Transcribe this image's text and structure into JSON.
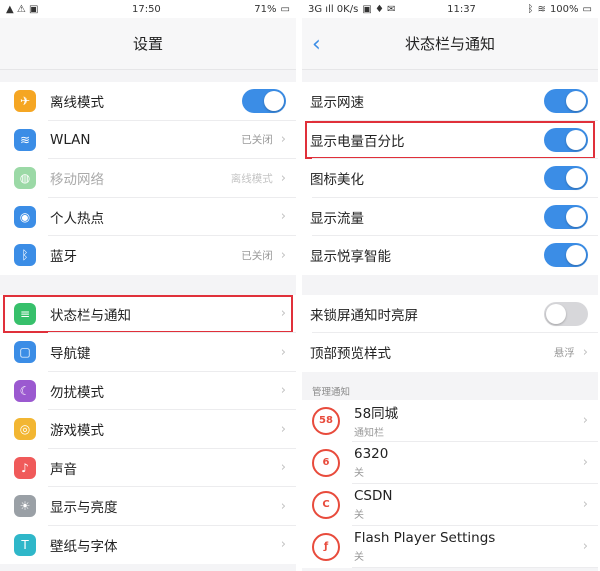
{
  "left": {
    "status": {
      "time": "17:50",
      "battery": "71%"
    },
    "title": "设置",
    "groups": [
      [
        {
          "label": "离线模式",
          "icon": "airplane-icon",
          "color": "#f5a623",
          "glyph": "✈",
          "control": "toggle-on"
        },
        {
          "label": "WLAN",
          "icon": "wifi-icon",
          "color": "#3b8de6",
          "glyph": "≋",
          "value": "已关闭"
        },
        {
          "label": "移动网络",
          "icon": "mobile-network-icon",
          "color": "#9bd9a6",
          "glyph": "◍",
          "value": "离线模式",
          "disabled": true
        },
        {
          "label": "个人热点",
          "icon": "hotspot-icon",
          "color": "#3b8de6",
          "glyph": "◉"
        },
        {
          "label": "蓝牙",
          "icon": "bluetooth-icon",
          "color": "#3b8de6",
          "glyph": "ᛒ",
          "value": "已关闭"
        }
      ],
      [
        {
          "label": "状态栏与通知",
          "icon": "statusbar-icon",
          "color": "#37c06b",
          "glyph": "≡",
          "highlight": true
        },
        {
          "label": "导航键",
          "icon": "navigation-key-icon",
          "color": "#3b8de6",
          "glyph": "▢"
        },
        {
          "label": "勿扰模式",
          "icon": "moon-icon",
          "color": "#9b59d0",
          "glyph": "☾"
        },
        {
          "label": "游戏模式",
          "icon": "gamepad-icon",
          "color": "#f2b632",
          "glyph": "◎"
        },
        {
          "label": "声音",
          "icon": "sound-icon",
          "color": "#f05a5a",
          "glyph": "♪"
        },
        {
          "label": "显示与亮度",
          "icon": "brightness-icon",
          "color": "#9aa0a6",
          "glyph": "☀"
        },
        {
          "label": "壁纸与字体",
          "icon": "wallpaper-font-icon",
          "color": "#2fb7c9",
          "glyph": "T"
        }
      ]
    ]
  },
  "right": {
    "status": {
      "left": "3G ıll 0K/s",
      "time": "11:37",
      "battery": "100%"
    },
    "title": "状态栏与通知",
    "groups": [
      [
        {
          "label": "显示网速",
          "control": "toggle-on"
        },
        {
          "label": "显示电量百分比",
          "control": "toggle-on",
          "highlight": true
        },
        {
          "label": "图标美化",
          "control": "toggle-on"
        },
        {
          "label": "显示流量",
          "control": "toggle-on"
        },
        {
          "label": "显示悦享智能",
          "control": "toggle-on"
        }
      ],
      [
        {
          "label": "来锁屏通知时亮屏",
          "control": "toggle-off"
        },
        {
          "label": "顶部预览样式",
          "value": "悬浮"
        }
      ]
    ],
    "section_header": "管理通知",
    "apps": [
      {
        "name": "58同城",
        "sub": "通知栏",
        "color": "#e84b3c",
        "glyph": "58"
      },
      {
        "name": "6320",
        "sub": "关",
        "color": "#e84b3c",
        "glyph": "6"
      },
      {
        "name": "CSDN",
        "sub": "关",
        "color": "#e84b3c",
        "glyph": "C"
      },
      {
        "name": "Flash Player Settings",
        "sub": "关",
        "color": "#e84b3c",
        "glyph": "ƒ"
      }
    ]
  }
}
